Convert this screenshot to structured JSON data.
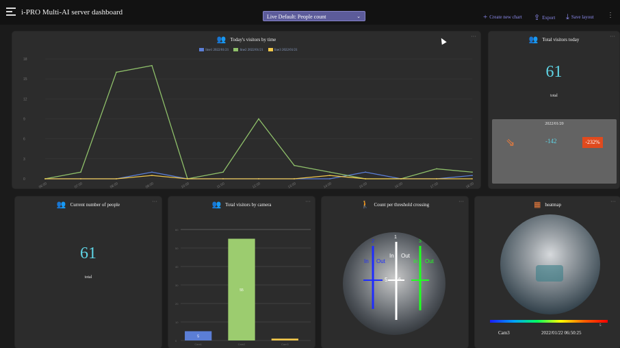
{
  "app": {
    "title": "i-PRO Multi-AI server dashboard"
  },
  "view_select": {
    "value": "Live Default: People count"
  },
  "actions": {
    "create": "Create new chart",
    "export": "Export",
    "save": "Save layout"
  },
  "icons": {
    "menu": "menu-icon",
    "plus": "plus-icon",
    "export": "export-icon",
    "save": "save-icon",
    "people": "people-group-icon",
    "walker": "walking-person-icon",
    "map": "map-icon",
    "trend": "trend-icon"
  },
  "colors": {
    "accent": "#8e8cf0",
    "orange": "#ea7b3c",
    "cyan": "#5fd5e6",
    "line1": "#5b7ed6",
    "line2": "#8fc06a",
    "line3": "#f2c84b",
    "neg_badge": "#e04a1e"
  },
  "visitors_by_time": {
    "title": "Today's visitors by time",
    "legend": [
      "line1 2022/01/21",
      "line2 2022/01/21",
      "line3 2022/01/21"
    ]
  },
  "total_today": {
    "title": "Total visitors today",
    "value": "61",
    "unit": "total",
    "compare_date": "2022/01/20",
    "diff": "-142",
    "pct": "-232%"
  },
  "current_people": {
    "title": "Current number of people",
    "value": "61",
    "unit": "total"
  },
  "by_camera": {
    "title": "Total visitors by camera"
  },
  "threshold": {
    "title": "Count per threshold crossing",
    "lines": [
      {
        "num": "2",
        "in": "In",
        "out": "Out",
        "count": "5",
        "color": "#1e2cff"
      },
      {
        "num": "1",
        "in": "In",
        "out": "Out",
        "count": "6",
        "color": "#ffffff"
      },
      {
        "num": "3",
        "in": "In",
        "out": "Out",
        "count": "",
        "color": "#20ff20"
      }
    ]
  },
  "heatmap": {
    "title": "heatmap",
    "camera": "Cam3",
    "timestamp": "2022/01/22 06:50:25",
    "scale_max": "5"
  },
  "chart_data": [
    {
      "type": "line",
      "title": "Today's visitors by time",
      "x": [
        "06:00",
        "07:00",
        "08:00",
        "09:00",
        "10:00",
        "11:00",
        "12:00",
        "13:00",
        "14:00",
        "15:00",
        "16:00",
        "17:00",
        "18:00"
      ],
      "ylim": [
        0,
        18
      ],
      "yticks": [
        0,
        3,
        6,
        9,
        12,
        15,
        18
      ],
      "series": [
        {
          "name": "line1 2022/01/21",
          "color": "#5b7ed6",
          "values": [
            0,
            0,
            0,
            1,
            0,
            0,
            0,
            0,
            0,
            1,
            0,
            0,
            0.5
          ]
        },
        {
          "name": "line2 2022/01/21",
          "color": "#8fc06a",
          "values": [
            0,
            1,
            16,
            17,
            0,
            1,
            9,
            2,
            1,
            0,
            0,
            1.5,
            1
          ]
        },
        {
          "name": "line3 2022/01/21",
          "color": "#f2c84b",
          "values": [
            0,
            0,
            0,
            0.5,
            0,
            0,
            0,
            0,
            0.5,
            0,
            0,
            0,
            0
          ]
        }
      ],
      "grid": true
    },
    {
      "type": "bar",
      "title": "Total visitors by camera",
      "categories": [
        "Cam1",
        "Cam2",
        "Cam3"
      ],
      "values": [
        5,
        55,
        1
      ],
      "value_labels": [
        "5",
        "55",
        ""
      ],
      "colors": [
        "#5b7ed6",
        "#9ccc6f",
        "#f2c84b"
      ],
      "ylim": [
        0,
        60
      ],
      "yticks": [
        0,
        10,
        20,
        30,
        40,
        50,
        60
      ],
      "grid": true
    }
  ]
}
